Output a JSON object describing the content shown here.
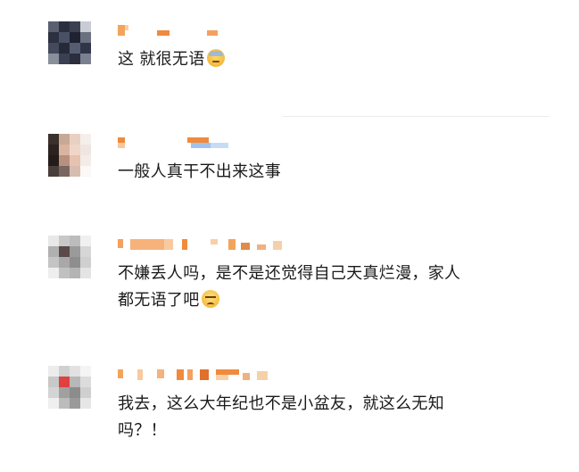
{
  "comments": [
    {
      "text": "这 就很无语",
      "emoji": "sweat-face-emoji"
    },
    {
      "text": "一般人真干不出来这事"
    },
    {
      "text_line1": "不嫌丢人吗，是不是还觉得自己天真烂漫，家人",
      "text_line2": "都无语了吧",
      "emoji": "unamused-face-emoji"
    },
    {
      "text_line1": "我去，这么大年纪也不是小盆友，就这么无知",
      "text_line2": "吗？！"
    }
  ]
}
